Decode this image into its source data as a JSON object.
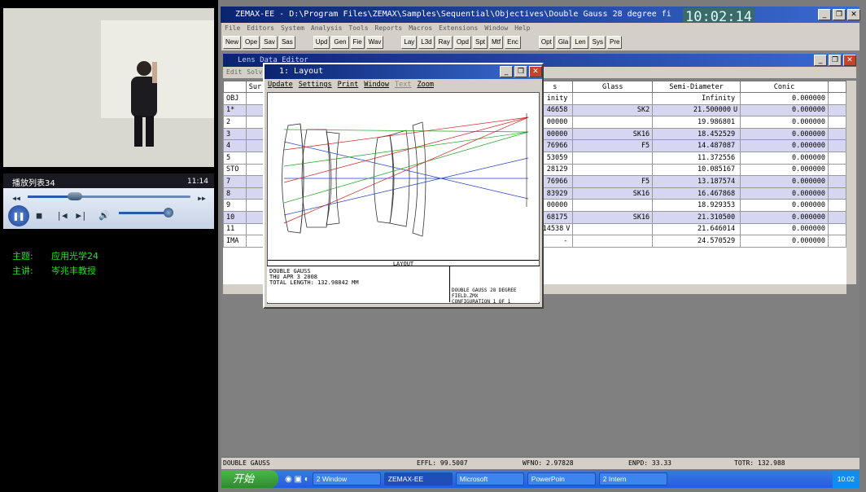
{
  "player": {
    "playlist_title": "播放列表34",
    "duration": "11:14",
    "progress_fraction": 0.29,
    "volume_fraction": 0.93,
    "subject_label": "主题:",
    "subject_value": "应用光学24",
    "speaker_label": "主讲:",
    "speaker_value": "岑兆丰教授"
  },
  "app": {
    "title": "ZEMAX-EE - D:\\Program Files\\ZEMAX\\Samples\\Sequential\\Objectives\\Double Gauss 28 degree fi",
    "clock": "10:02:14",
    "menu": [
      "File",
      "Editors",
      "System",
      "Analysis",
      "Tools",
      "Reports",
      "Macros",
      "Extensions",
      "Window",
      "Help"
    ],
    "toolbar": [
      "New",
      "Ope",
      "Sav",
      "Sas",
      "Upd",
      "Gen",
      "Fie",
      "Wav",
      "Lay",
      "L3d",
      "Ray",
      "Opd",
      "Spt",
      "Mtf",
      "Enc",
      "Opt",
      "Gla",
      "Len",
      "Sys",
      "Pre"
    ]
  },
  "lde": {
    "title": "Lens Data Editor",
    "menu": [
      "Edit",
      "Solves"
    ],
    "headers": {
      "surf": "Sur",
      "thickness": "s",
      "glass": "Glass",
      "semi": "Semi-Diameter",
      "conic": "Conic"
    },
    "rows": [
      {
        "surf": "OBJ",
        "thick": "inity",
        "mark": "",
        "glass": "",
        "semi": "Infinity",
        "flag": "",
        "conic": "0.000000",
        "sel": false
      },
      {
        "surf": "1*",
        "thick": "46658",
        "mark": "",
        "glass": "SK2",
        "semi": "21.500000",
        "flag": "U",
        "conic": "0.000000",
        "sel": true
      },
      {
        "surf": "2",
        "thick": "00000",
        "mark": "",
        "glass": "",
        "semi": "19.986801",
        "flag": "",
        "conic": "0.000000",
        "sel": false
      },
      {
        "surf": "3",
        "thick": "00000",
        "mark": "",
        "glass": "SK16",
        "semi": "18.452529",
        "flag": "",
        "conic": "0.000000",
        "sel": true
      },
      {
        "surf": "4",
        "thick": "76966",
        "mark": "",
        "glass": "F5",
        "semi": "14.487087",
        "flag": "",
        "conic": "0.000000",
        "sel": true
      },
      {
        "surf": "5",
        "thick": "53059",
        "mark": "",
        "glass": "",
        "semi": "11.372556",
        "flag": "",
        "conic": "0.000000",
        "sel": false
      },
      {
        "surf": "STO",
        "thick": "28129",
        "mark": "",
        "glass": "",
        "semi": "10.085167",
        "flag": "",
        "conic": "0.000000",
        "sel": false
      },
      {
        "surf": "7",
        "thick": "76966",
        "mark": "",
        "glass": "F5",
        "semi": "13.187574",
        "flag": "",
        "conic": "0.000000",
        "sel": true
      },
      {
        "surf": "8",
        "thick": "83929",
        "mark": "",
        "glass": "SK16",
        "semi": "16.467868",
        "flag": "",
        "conic": "0.000000",
        "sel": true
      },
      {
        "surf": "9",
        "thick": "00000",
        "mark": "",
        "glass": "",
        "semi": "18.929353",
        "flag": "",
        "conic": "0.000000",
        "sel": false
      },
      {
        "surf": "10",
        "thick": "68175",
        "mark": "",
        "glass": "SK16",
        "semi": "21.310500",
        "flag": "",
        "conic": "0.000000",
        "sel": true
      },
      {
        "surf": "11",
        "thick": "14538",
        "mark": "V",
        "glass": "",
        "semi": "21.646014",
        "flag": "",
        "conic": "0.000000",
        "sel": false
      },
      {
        "surf": "IMA",
        "thick": "-",
        "mark": "",
        "glass": "",
        "semi": "24.570529",
        "flag": "",
        "conic": "0.000000",
        "sel": false
      }
    ]
  },
  "layout": {
    "title": "1: Layout",
    "menu": [
      "Update",
      "Settings",
      "Print",
      "Window",
      "Text",
      "Zoom"
    ],
    "caption": "LAYOUT",
    "info_line1": "DOUBLE GAUSS",
    "info_line2": "THU APR 3 2008",
    "info_line3": "TOTAL LENGTH:  132.98842 MM",
    "file_line": "DOUBLE GAUSS 28 DEGREE FIELD.ZMX",
    "config_line": "CONFIGURATION 1 OF 1"
  },
  "status": {
    "name": "DOUBLE GAUSS",
    "effl": "EFFL: 99.5007",
    "wfno": "WFNO: 2.97828",
    "enpd": "ENPD: 33.33",
    "totr": "TOTR: 132.988"
  },
  "taskbar": {
    "start": "开始",
    "tasks": [
      "2 Window",
      "ZEMAX-EE",
      "Microsoft",
      "PowerPoin",
      "2 Intern"
    ],
    "time": "10:02"
  }
}
